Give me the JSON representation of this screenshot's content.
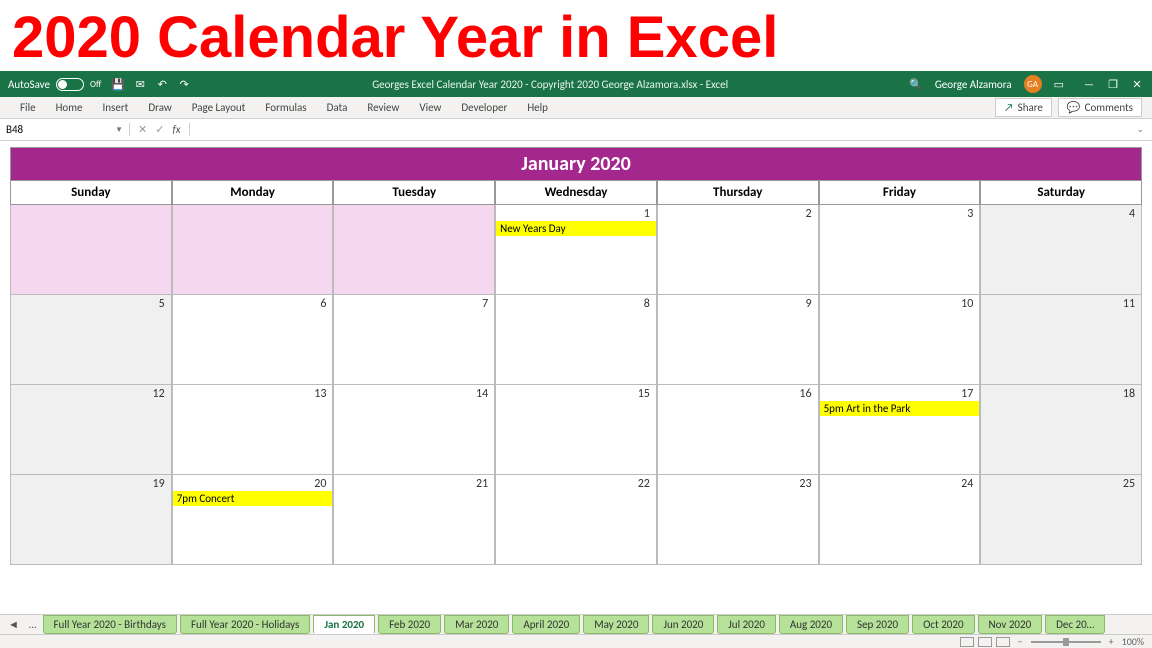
{
  "banner": "2020 Calendar Year in Excel",
  "titlebar": {
    "autosave_label": "AutoSave",
    "autosave_state": "Off",
    "filename": "Georges Excel Calendar Year 2020 - Copyright 2020  George Alzamora.xlsx  -  Excel",
    "user": "George Alzamora",
    "initials": "GA"
  },
  "ribbon": {
    "tabs": [
      "File",
      "Home",
      "Insert",
      "Draw",
      "Page Layout",
      "Formulas",
      "Data",
      "Review",
      "View",
      "Developer",
      "Help"
    ],
    "share": "Share",
    "comments": "Comments"
  },
  "formula": {
    "namebox": "B48",
    "fx": "fx",
    "value": ""
  },
  "calendar": {
    "title": "January 2020",
    "days": [
      "Sunday",
      "Monday",
      "Tuesday",
      "Wednesday",
      "Thursday",
      "Friday",
      "Saturday"
    ],
    "rows": [
      [
        {
          "num": "",
          "class": "pink"
        },
        {
          "num": "",
          "class": "pink"
        },
        {
          "num": "",
          "class": "pink"
        },
        {
          "num": "1",
          "event": "New Years Day"
        },
        {
          "num": "2"
        },
        {
          "num": "3"
        },
        {
          "num": "4",
          "class": "out"
        }
      ],
      [
        {
          "num": "5",
          "class": "out"
        },
        {
          "num": "6"
        },
        {
          "num": "7"
        },
        {
          "num": "8"
        },
        {
          "num": "9"
        },
        {
          "num": "10"
        },
        {
          "num": "11",
          "class": "out"
        }
      ],
      [
        {
          "num": "12",
          "class": "out"
        },
        {
          "num": "13"
        },
        {
          "num": "14"
        },
        {
          "num": "15"
        },
        {
          "num": "16"
        },
        {
          "num": "17",
          "event": "5pm Art in the Park"
        },
        {
          "num": "18",
          "class": "out"
        }
      ],
      [
        {
          "num": "19",
          "class": "out"
        },
        {
          "num": "20",
          "event": "7pm Concert"
        },
        {
          "num": "21"
        },
        {
          "num": "22"
        },
        {
          "num": "23"
        },
        {
          "num": "24"
        },
        {
          "num": "25",
          "class": "out"
        }
      ]
    ]
  },
  "sheets": {
    "nav_left": "◄",
    "nav_more": "…",
    "tabs": [
      "Full Year 2020 - Birthdays",
      "Full Year 2020 - Holidays",
      "Jan 2020",
      "Feb 2020",
      "Mar 2020",
      "April 2020",
      "May 2020",
      "Jun 2020",
      "Jul 2020",
      "Aug 2020",
      "Sep 2020",
      "Oct 2020",
      "Nov 2020",
      "Dec 20…"
    ],
    "active_index": 2
  },
  "status": {
    "zoom_minus": "−",
    "zoom_plus": "+",
    "zoom": "100%"
  }
}
